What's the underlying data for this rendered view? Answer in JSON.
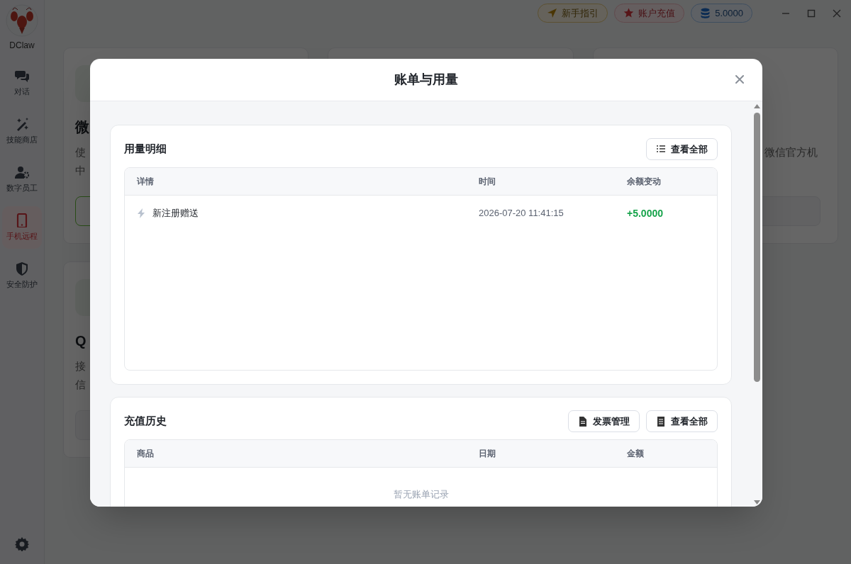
{
  "sidebar": {
    "logo_label": "DClaw",
    "items": [
      {
        "kind": "chat",
        "label": "对话",
        "selected": false
      },
      {
        "kind": "skills",
        "label": "技能商店",
        "selected": false
      },
      {
        "kind": "staff",
        "label": "数字员工",
        "selected": false
      },
      {
        "kind": "phone",
        "label": "手机远程",
        "selected": true
      },
      {
        "kind": "shield",
        "label": "安全防护",
        "selected": false
      }
    ]
  },
  "topbar": {
    "buttons": [
      {
        "kind": "guide",
        "label": "新手指引"
      },
      {
        "kind": "recharge",
        "label": "账户充值"
      },
      {
        "kind": "balance",
        "label": "5.0000"
      }
    ]
  },
  "background_cards": [
    {
      "title": "微",
      "lines": [
        "使",
        "中"
      ]
    },
    {
      "lines": [
        "微信官方机"
      ]
    },
    {
      "title": "Q",
      "lines": [
        "接",
        "信"
      ]
    }
  ],
  "modal": {
    "title": "账单与用量",
    "sections": [
      {
        "title": "用量明细",
        "buttons": [
          {
            "kind": "list",
            "label": "查看全部"
          }
        ],
        "columns": [
          "详情",
          "时间",
          "余额变动"
        ],
        "rows": [
          {
            "detail": "新注册赠送",
            "time": "2026-07-20 11:41:15",
            "change": "+5.0000"
          }
        ]
      },
      {
        "title": "充值历史",
        "buttons": [
          {
            "kind": "invoice",
            "label": "发票管理"
          },
          {
            "kind": "receipt",
            "label": "查看全部"
          }
        ],
        "columns": [
          "商品",
          "日期",
          "金额"
        ],
        "empty_text": "暂无账单记录"
      }
    ]
  }
}
